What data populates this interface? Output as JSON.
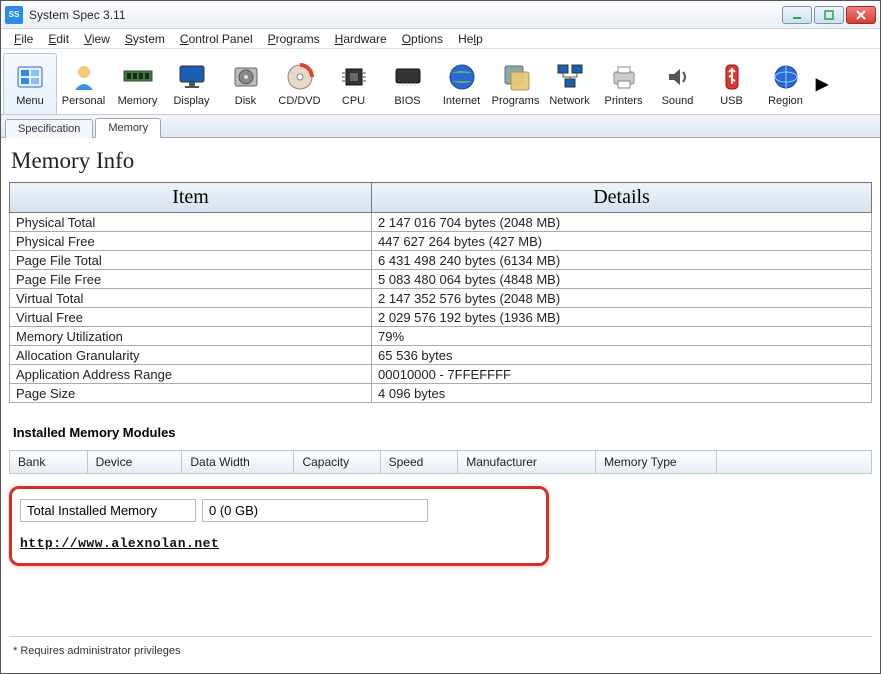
{
  "titlebar": {
    "title": "System Spec 3.11"
  },
  "menu": [
    "File",
    "Edit",
    "View",
    "System",
    "Control Panel",
    "Programs",
    "Hardware",
    "Options",
    "Help"
  ],
  "toolbar": [
    {
      "label": "Menu",
      "icon": "menu"
    },
    {
      "label": "Personal",
      "icon": "personal"
    },
    {
      "label": "Memory",
      "icon": "memory"
    },
    {
      "label": "Display",
      "icon": "display"
    },
    {
      "label": "Disk",
      "icon": "disk"
    },
    {
      "label": "CD/DVD",
      "icon": "cd"
    },
    {
      "label": "CPU",
      "icon": "cpu"
    },
    {
      "label": "BIOS",
      "icon": "bios"
    },
    {
      "label": "Internet",
      "icon": "internet"
    },
    {
      "label": "Programs",
      "icon": "programs"
    },
    {
      "label": "Network",
      "icon": "network"
    },
    {
      "label": "Printers",
      "icon": "printers"
    },
    {
      "label": "Sound",
      "icon": "sound"
    },
    {
      "label": "USB",
      "icon": "usb"
    },
    {
      "label": "Region",
      "icon": "region"
    }
  ],
  "tabs": {
    "spec": "Specification",
    "memory": "Memory",
    "active": "memory"
  },
  "page": {
    "title": "Memory Info"
  },
  "columns": {
    "item": "Item",
    "details": "Details"
  },
  "rows": [
    {
      "item": "Physical Total",
      "details": "2 147 016 704 bytes   (2048 MB)"
    },
    {
      "item": "Physical Free",
      "details": "447 627 264 bytes   (427 MB)"
    },
    {
      "item": "Page File Total",
      "details": "6 431 498 240 bytes   (6134 MB)"
    },
    {
      "item": "Page File Free",
      "details": "5 083 480 064 bytes   (4848 MB)"
    },
    {
      "item": "Virtual Total",
      "details": "2 147 352 576 bytes   (2048 MB)"
    },
    {
      "item": "Virtual Free",
      "details": "2 029 576 192 bytes   (1936 MB)"
    },
    {
      "item": "Memory Utilization",
      "details": "79%"
    },
    {
      "item": "Allocation Granularity",
      "details": "65 536 bytes"
    },
    {
      "item": "Application Address Range",
      "details": "00010000 - 7FFEFFFF"
    },
    {
      "item": "Page Size",
      "details": "4 096 bytes"
    }
  ],
  "modules": {
    "title": "Installed Memory Modules",
    "headers": [
      "Bank",
      "Device",
      "Data Width",
      "Capacity",
      "Speed",
      "Manufacturer",
      "Memory Type"
    ]
  },
  "total": {
    "label": "Total Installed Memory",
    "value": "0 (0 GB)"
  },
  "link": "http://www.alexnolan.net",
  "footer": "*  Requires administrator privileges"
}
